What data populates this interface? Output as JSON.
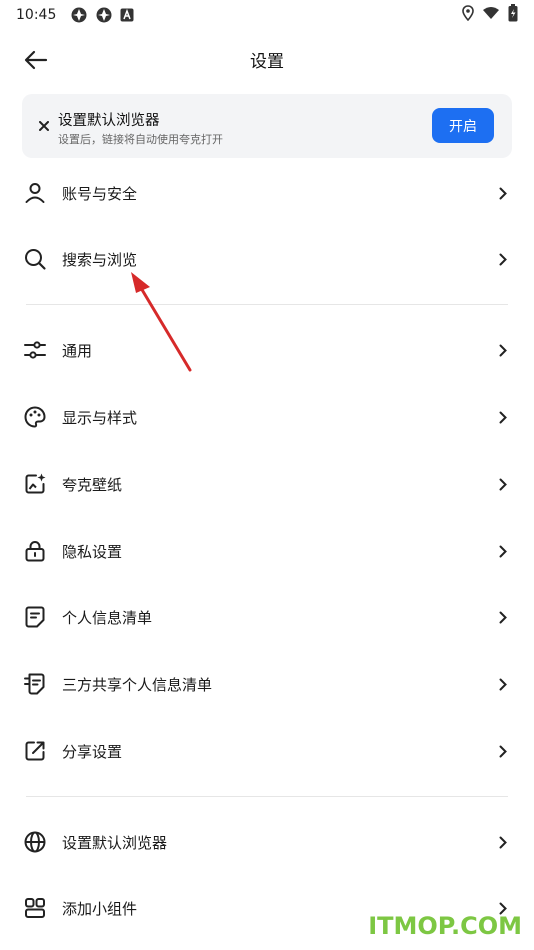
{
  "status_bar": {
    "time": "10:45"
  },
  "header": {
    "title": "设置"
  },
  "banner": {
    "title": "设置默认浏览器",
    "subtitle": "设置后，链接将自动使用夸克打开",
    "button_label": "开启"
  },
  "menu_group1": [
    {
      "label": "账号与安全",
      "icon": "person-icon"
    },
    {
      "label": "搜索与浏览",
      "icon": "search-icon"
    }
  ],
  "menu_group2": [
    {
      "label": "通用",
      "icon": "sliders-icon"
    },
    {
      "label": "显示与样式",
      "icon": "palette-icon"
    },
    {
      "label": "夸克壁纸",
      "icon": "wallpaper-icon"
    },
    {
      "label": "隐私设置",
      "icon": "lock-icon"
    },
    {
      "label": "个人信息清单",
      "icon": "document-icon"
    },
    {
      "label": "三方共享个人信息清单",
      "icon": "shared-document-icon"
    },
    {
      "label": "分享设置",
      "icon": "share-icon"
    }
  ],
  "menu_group3": [
    {
      "label": "设置默认浏览器",
      "icon": "globe-icon"
    },
    {
      "label": "添加小组件",
      "icon": "widget-icon"
    }
  ],
  "watermark": "ITMOP.COM",
  "colors": {
    "accent": "#1d6ff2",
    "annotation_arrow": "#d62a2a",
    "watermark": "#7dc743"
  }
}
